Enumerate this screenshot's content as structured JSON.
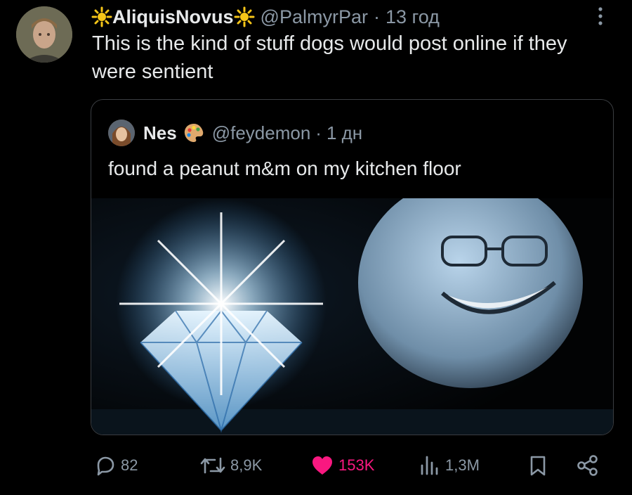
{
  "post": {
    "display_name": "AliquisNovus",
    "handle": "@PalmyrPar",
    "separator": "·",
    "time": "13 год",
    "text": "This is the kind of stuff dogs would post online if they were sentient"
  },
  "quoted": {
    "display_name": "Nes",
    "handle": "@feydemon",
    "separator": "·",
    "time": "1 дн",
    "text": "found a peanut m&m on my kitchen floor"
  },
  "actions": {
    "replies": "82",
    "reposts": "8,9K",
    "likes": "153K",
    "views": "1,3M"
  },
  "icons": {
    "name_decoration": "sun-emoji-icon",
    "quoted_decoration": "artist-palette-emoji-icon",
    "more": "more-vertical-icon",
    "reply": "reply-icon",
    "repost": "repost-icon",
    "like": "heart-icon",
    "views": "views-icon",
    "bookmark": "bookmark-icon",
    "share": "share-icon"
  },
  "colors": {
    "background": "#000000",
    "text": "#e7e9ea",
    "muted": "#8b98a5",
    "like": "#f91880",
    "border": "#3a3d41"
  }
}
